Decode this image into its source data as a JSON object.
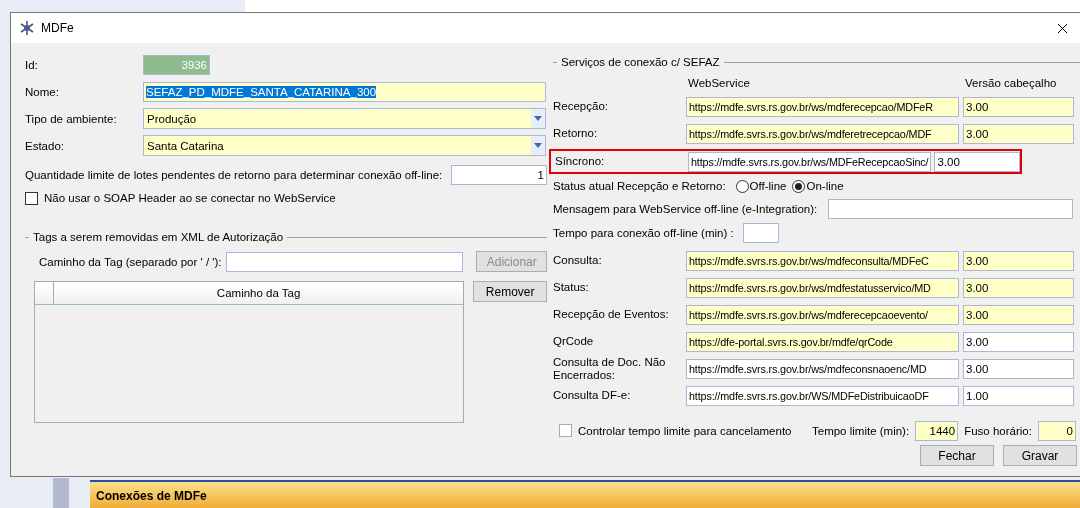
{
  "window": {
    "title": "MDFe"
  },
  "left": {
    "fields": [
      {
        "kind": "id",
        "label": "Id:",
        "value": "3936"
      },
      {
        "kind": "text",
        "label": "Nome:",
        "value": "SEFAZ_PD_MDFE_SANTA_CATARINA_300",
        "text_selected": true
      },
      {
        "kind": "select",
        "label": "Tipo de ambiente:",
        "value": "Produção"
      },
      {
        "kind": "select",
        "label": "Estado:",
        "value": "Santa Catarina"
      }
    ],
    "limit": {
      "label": "Quantidade limite de lotes pendentes de retorno para determinar conexão off-line:",
      "value": "1"
    },
    "soap": {
      "label": "Não usar o SOAP Header ao se conectar no WebService",
      "checked": false
    },
    "tags": {
      "title": "Tags a serem removidas em XML de Autorização",
      "path_label": "Caminho da Tag (separado por ' / '):",
      "add_button": {
        "label": "Adicionar",
        "disabled": true
      },
      "column": "Caminho da Tag",
      "remove_button": {
        "label": "Remover",
        "disabled": false
      }
    }
  },
  "right": {
    "title": "Serviços de conexão c/ SEFAZ",
    "headers": [
      "WebService",
      "Versão cabeçalho"
    ],
    "services_top": [
      {
        "label": "Recepção:",
        "url": "https://mdfe.svrs.rs.gov.br/ws/mdferecepcao/MDFeR",
        "version": "3.00",
        "url_required": true,
        "version_required": true,
        "highlighted": false
      },
      {
        "label": "Retorno:",
        "url": "https://mdfe.svrs.rs.gov.br/ws/mdferetrecepcao/MDF",
        "version": "3.00",
        "url_required": true,
        "version_required": true,
        "highlighted": false
      },
      {
        "label": "Síncrono:",
        "url": "https://mdfe.svrs.rs.gov.br/ws/MDFeRecepcaoSinc/",
        "version": "3.00",
        "url_required": false,
        "version_required": false,
        "highlighted": true
      }
    ],
    "status": {
      "label": "Status atual Recepção e Retorno:",
      "options": [
        {
          "label": "Off-line",
          "selected": false
        },
        {
          "label": "On-line",
          "selected": true
        }
      ]
    },
    "message": {
      "label": "Mensagem para WebService off-line (e-Integration):"
    },
    "offline_time": {
      "label": "Tempo para conexão off-line (min) :"
    },
    "services_bottom": [
      {
        "label": "Consulta:",
        "url": "https://mdfe.svrs.rs.gov.br/ws/mdfeconsulta/MDFeC",
        "version": "3.00",
        "url_required": true,
        "version_required": true,
        "highlighted": false
      },
      {
        "label": "Status:",
        "url": "https://mdfe.svrs.rs.gov.br/ws/mdfestatusservico/MD",
        "version": "3.00",
        "url_required": true,
        "version_required": true,
        "highlighted": false
      },
      {
        "label": "Recepção de Eventos:",
        "url": "https://mdfe.svrs.rs.gov.br/ws/mdferecepcaoevento/",
        "version": "3.00",
        "url_required": true,
        "version_required": true,
        "highlighted": false
      },
      {
        "label": "QrCode",
        "url": "https://dfe-portal.svrs.rs.gov.br/mdfe/qrCode",
        "version": "3.00",
        "url_required": true,
        "version_required": false,
        "highlighted": false
      },
      {
        "label": "Consulta de Doc. Não Encerrados:",
        "url": "https://mdfe.svrs.rs.gov.br/ws/mdfeconsnaoenc/MD",
        "version": "3.00",
        "url_required": false,
        "version_required": false,
        "highlighted": false
      },
      {
        "label": "Consulta DF-e:",
        "url": "https://mdfe.svrs.rs.gov.br/WS/MDFeDistribuicaoDF",
        "version": "1.00",
        "url_required": false,
        "version_required": false,
        "highlighted": false
      }
    ],
    "cancel_control": {
      "label": "Controlar tempo limite para cancelamento",
      "checked": false
    },
    "time_limit": {
      "label": "Tempo limite (min):",
      "value": "1440"
    },
    "timezone": {
      "label": "Fuso horário:",
      "value": "0"
    }
  },
  "buttons": [
    {
      "label": "Fechar"
    },
    {
      "label": "Gravar"
    }
  ],
  "background": {
    "panel_title": "Conexões de MDFe"
  }
}
